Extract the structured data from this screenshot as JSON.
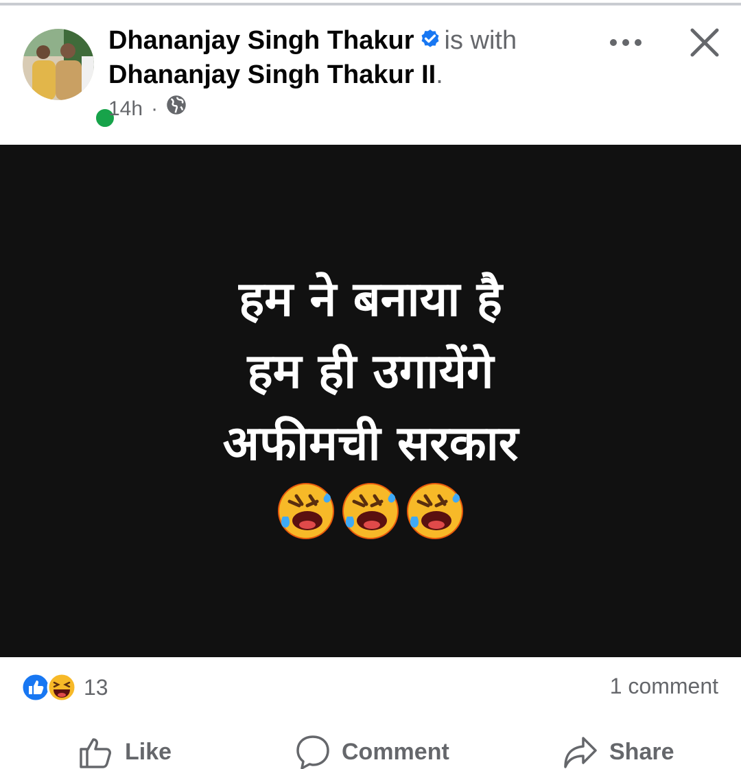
{
  "post": {
    "author": "Dhananjay Singh Thakur",
    "with_text": "is with",
    "tagged": "Dhananjay Singh Thakur II",
    "tagged_suffix": ".",
    "time": "14h",
    "separator": "·",
    "audience_icon": "globe-icon",
    "image_text": {
      "line1": "हम ने बनाया है",
      "line2": "हम ही उगायेंगे",
      "line3": "अफीमची सरकार",
      "emoji_icon": "rolling-on-floor-laughing-emoji"
    }
  },
  "engagement": {
    "reaction_icons": [
      "like-reaction-icon",
      "haha-reaction-icon"
    ],
    "reaction_count": "13",
    "comment_count": "1 comment"
  },
  "actions": {
    "like": "Like",
    "comment": "Comment",
    "share": "Share"
  },
  "colors": {
    "accent": "#1877f2",
    "text": "#050505",
    "secondary_text": "#65676b",
    "online": "#17a34a",
    "image_background": "#111111"
  }
}
